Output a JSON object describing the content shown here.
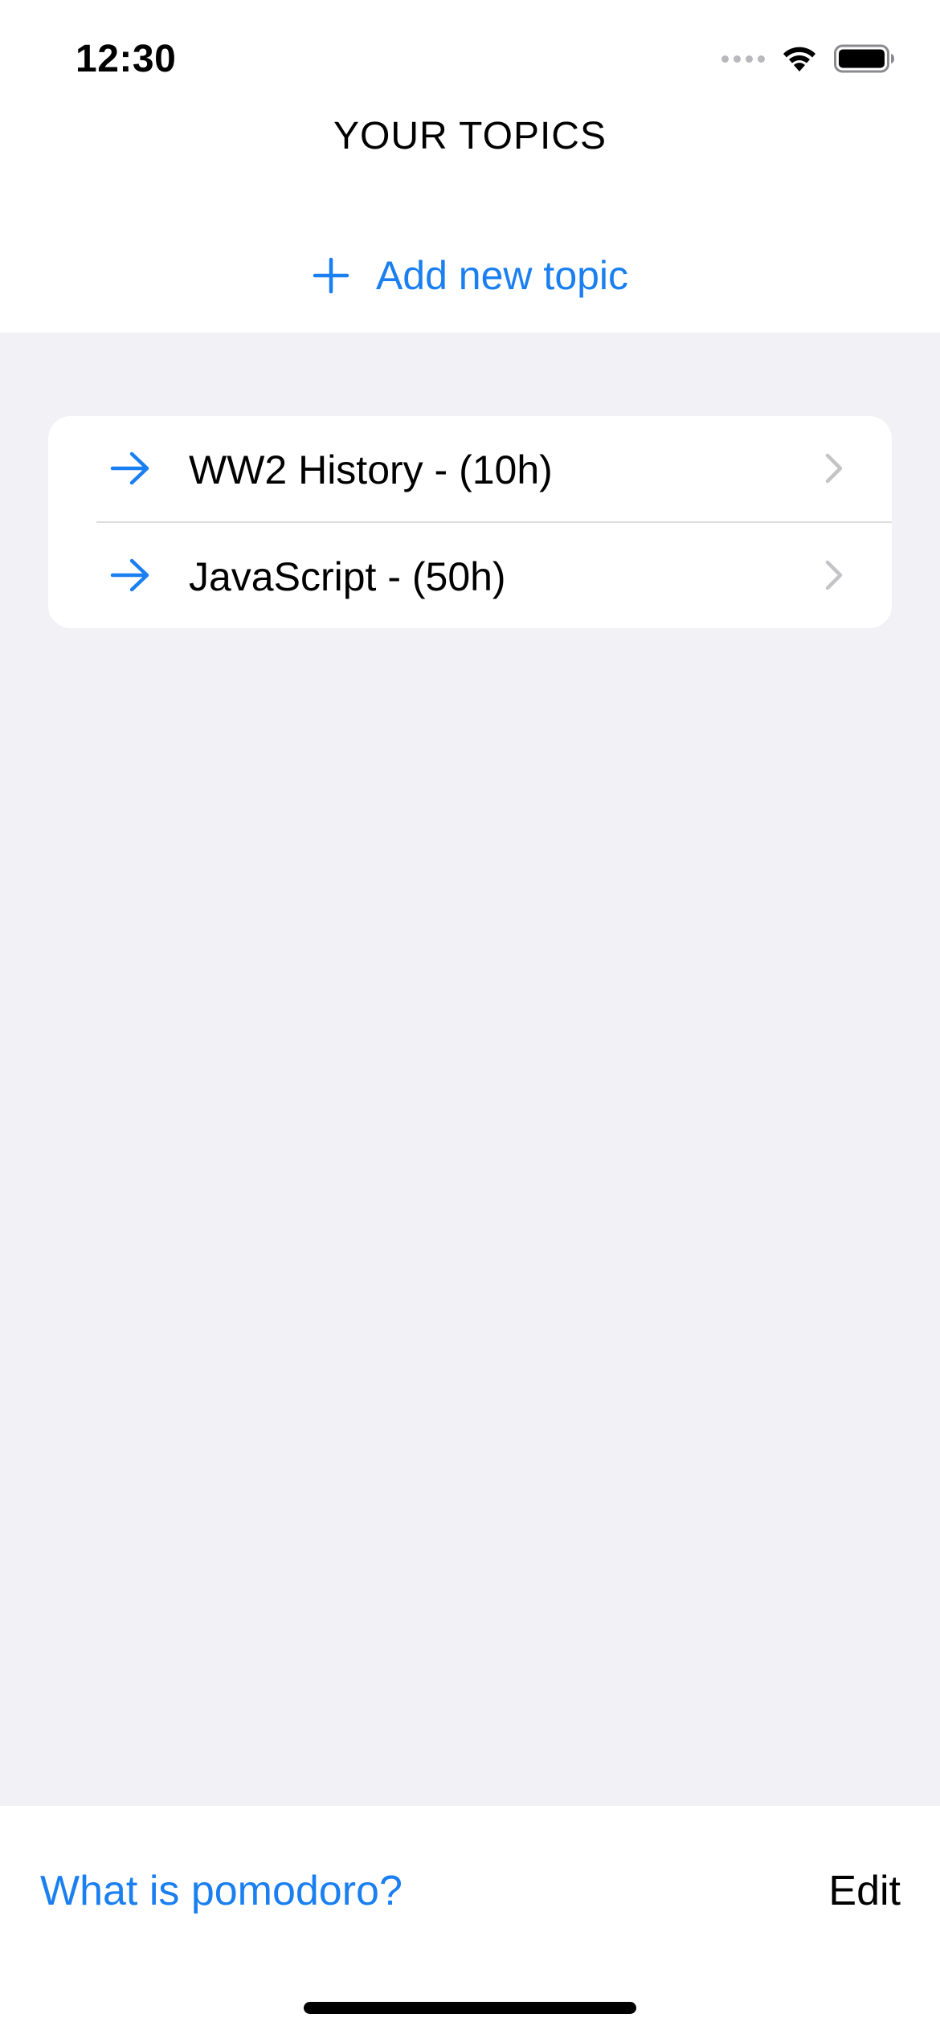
{
  "status_bar": {
    "time": "12:30",
    "icons": [
      "signal-dots-icon",
      "wifi-icon",
      "battery-icon"
    ]
  },
  "header": {
    "title": "YOUR TOPICS"
  },
  "add_topic": {
    "icon": "plus-icon",
    "label": "Add new topic"
  },
  "topics": [
    {
      "icon": "arrow-right-icon",
      "label": "WW2 History - (10h)",
      "accessory": "chevron-right-icon"
    },
    {
      "icon": "arrow-right-icon",
      "label": "JavaScript - (50h)",
      "accessory": "chevron-right-icon"
    }
  ],
  "toolbar": {
    "pomodoro_label": "What is pomodoro?",
    "edit_label": "Edit"
  },
  "colors": {
    "accent": "#1a7ff0",
    "background": "#f1f1f6",
    "surface": "#ffffff",
    "chevron": "#c4c4c7"
  }
}
